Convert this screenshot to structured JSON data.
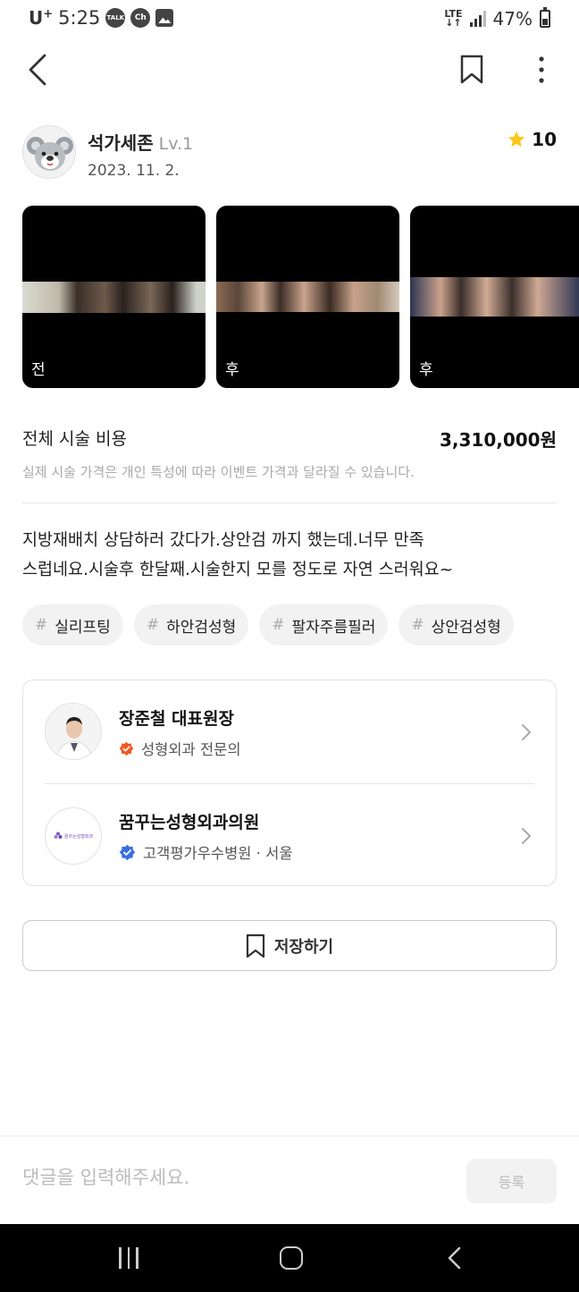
{
  "status_bar": {
    "carrier": "U",
    "carrier_plus": "+",
    "time": "5:25",
    "notif_talk": "TALK",
    "notif_ch": "Ch",
    "network": "LTE",
    "battery": "47%"
  },
  "header": {
    "back_icon": "chevron-left-icon",
    "bookmark_icon": "bookmark-icon",
    "more_icon": "more-vertical-icon"
  },
  "author": {
    "name": "석가세존",
    "level": "Lv.1",
    "date": "2023. 11. 2.",
    "rating": "10",
    "star_color": "#FFC61A"
  },
  "photos": [
    {
      "tag": "전"
    },
    {
      "tag": "후"
    },
    {
      "tag": "후"
    }
  ],
  "cost": {
    "label": "전체 시술 비용",
    "value": "3,310,000원",
    "note": "실제 시술 가격은 개인 특성에 따라 이벤트 가격과 달라질 수 있습니다."
  },
  "review": {
    "line1": "지방재배치 상담하러 갔다가.상안검 까지 했는데.너무 만족",
    "line2": "스럽네요.시술후 한달째.시술한지 모를 정도로 자연 스러워요~"
  },
  "tags": [
    "실리프팅",
    "하안검성형",
    "팔자주름필러",
    "상안검성형"
  ],
  "tag_hash": "#",
  "doctor": {
    "name": "장준철 대표원장",
    "specialty": "성형외과 전문의",
    "badge_color": "#F05A24"
  },
  "clinic": {
    "name": "꿈꾸는성형외과의원",
    "logo_text": "꿈꾸는성형외과",
    "info": "고객평가우수병원 · 서울",
    "badge_color": "#3B6FE0"
  },
  "save_button": {
    "label": "저장하기"
  },
  "comment": {
    "placeholder": "댓글을 입력해주세요.",
    "submit_label": "등록"
  }
}
